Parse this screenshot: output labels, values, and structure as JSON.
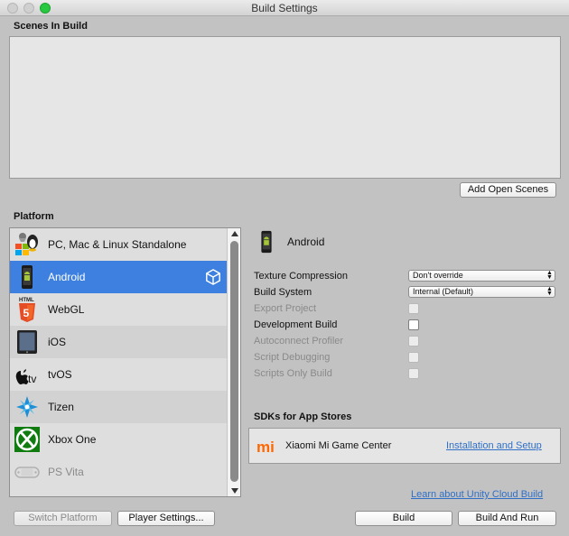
{
  "window": {
    "title": "Build Settings"
  },
  "scenes": {
    "label": "Scenes In Build",
    "add_open_scenes": "Add Open Scenes"
  },
  "platform": {
    "label": "Platform",
    "items": [
      {
        "name": "PC, Mac & Linux Standalone",
        "icon": "standalone-icon"
      },
      {
        "name": "Android",
        "icon": "android-icon"
      },
      {
        "name": "WebGL",
        "icon": "html5-icon"
      },
      {
        "name": "iOS",
        "icon": "ipad-icon"
      },
      {
        "name": "tvOS",
        "icon": "apple-tv-icon",
        "icon_text": "tv"
      },
      {
        "name": "Tizen",
        "icon": "tizen-icon"
      },
      {
        "name": "Xbox One",
        "icon": "xbox-icon"
      },
      {
        "name": "PS Vita",
        "icon": "ps-vita-icon"
      }
    ],
    "selected": "Android",
    "webgl_badge": "HTML"
  },
  "settings": {
    "platform_title": "Android",
    "rows": [
      {
        "label": "Texture Compression",
        "value": "Don't override"
      },
      {
        "label": "Build System",
        "value": "Internal (Default)"
      },
      {
        "label": "Export Project"
      },
      {
        "label": "Development Build"
      },
      {
        "label": "Autoconnect Profiler"
      },
      {
        "label": "Script Debugging"
      },
      {
        "label": "Scripts Only Build"
      }
    ],
    "sdks_title": "SDKs for App Stores",
    "sdk": {
      "name": "Xiaomi Mi Game Center",
      "link": "Installation and Setup",
      "logo_text": "mi"
    }
  },
  "footer": {
    "cloud_link": "Learn about Unity Cloud Build",
    "switch_platform": "Switch Platform",
    "player_settings": "Player Settings...",
    "build": "Build",
    "build_and_run": "Build And Run"
  },
  "colors": {
    "selection": "#3d80df",
    "link": "#2f6fc7",
    "xbox_green": "#107c10",
    "html5_orange": "#e44d26",
    "xiaomi_orange": "#ff6700"
  }
}
